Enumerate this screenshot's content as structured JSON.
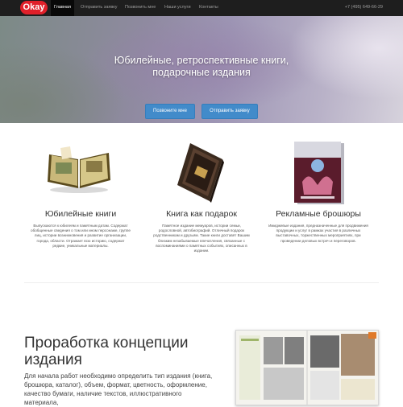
{
  "navbar": {
    "logo": "Okay",
    "items": [
      {
        "label": "Главная",
        "active": true
      },
      {
        "label": "Отправить заявку",
        "active": false
      },
      {
        "label": "Позвонить мне",
        "active": false
      },
      {
        "label": "Наши услуги",
        "active": false
      },
      {
        "label": "Контакты",
        "active": false
      }
    ],
    "phone": "+7 (495) 649-66-29"
  },
  "hero": {
    "title_line1": "Юбилейные, ретроспективные книги,",
    "title_line2": "подарочные издания",
    "call_button": "Позвоните мне",
    "request_button": "Отправить заявку"
  },
  "features": [
    {
      "title": "Юбилейные книги",
      "text": "Выпускаются к юбилеям и памятным датам. Содержат обобщенные сведения о том или ином персонаже, группе лиц, истории возникновения и развитие организации, города, области. Отражает всю историю, содержат редкие, уникальные материалы."
    },
    {
      "title": "Книга как подарок",
      "text": "Памятное издание мемуаров, истории семьи, родословной, автобиографий. Отличный подарок родственникам и друзьям. Такие книги доставят Вашим близким незабываемые впечатления, связанные с воспоминаниями о памятных событиях, описанных в издании."
    },
    {
      "title": "Рекламные брошюры",
      "text": "Имиджевые издания, предназначенные для продвижения продукции и услуг в рамках участия в различных выставочных, торжественных мероприятиях, при проведении деловых встреч и переговоров."
    }
  ],
  "concept": {
    "title": "Проработка концепции издания",
    "text": "Для начала работ необходимо определить тип издания (книга, брошюра, каталог), объем, формат, цветность, оформление, качество бумаги, наличие текстов, иллюстративного материала,"
  },
  "colors": {
    "navbar_bg": "#1e1e1e",
    "logo_red": "#e0202a",
    "button_blue": "#428bca"
  }
}
